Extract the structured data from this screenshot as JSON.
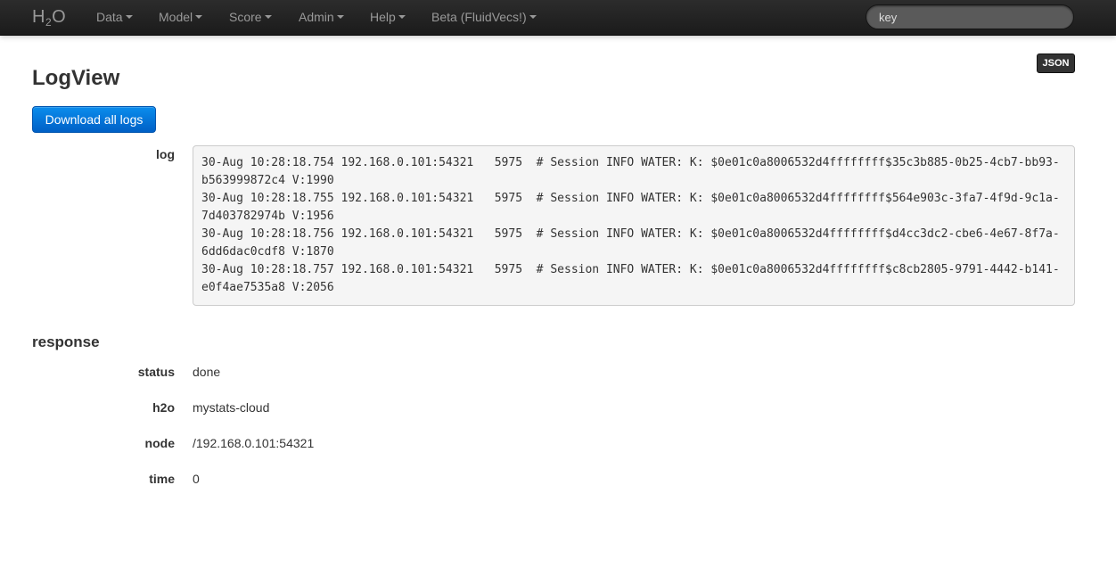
{
  "navbar": {
    "brand": {
      "main": "H",
      "sub": "2",
      "tail": "O"
    },
    "menu": [
      {
        "label": "Data"
      },
      {
        "label": "Model"
      },
      {
        "label": "Score"
      },
      {
        "label": "Admin"
      },
      {
        "label": "Help"
      },
      {
        "label": "Beta (FluidVecs!)"
      }
    ],
    "search": {
      "value": "",
      "placeholder": "key"
    }
  },
  "toolbar": {
    "json_label": "JSON"
  },
  "page": {
    "title": "LogView",
    "download_label": "Download all logs",
    "log_label": "log",
    "log_lines": [
      "30-Aug 10:28:18.754 192.168.0.101:54321   5975  # Session INFO WATER: K: $0e01c0a8006532d4ffffffff$35c3b885-0b25-4cb7-bb93-b563999872c4 V:1990",
      "30-Aug 10:28:18.755 192.168.0.101:54321   5975  # Session INFO WATER: K: $0e01c0a8006532d4ffffffff$564e903c-3fa7-4f9d-9c1a-7d403782974b V:1956",
      "30-Aug 10:28:18.756 192.168.0.101:54321   5975  # Session INFO WATER: K: $0e01c0a8006532d4ffffffff$d4cc3dc2-cbe6-4e67-8f7a-6dd6dac0cdf8 V:1870",
      "30-Aug 10:28:18.757 192.168.0.101:54321   5975  # Session INFO WATER: K: $0e01c0a8006532d4ffffffff$c8cb2805-9791-4442-b141-e0f4ae7535a8 V:2056"
    ]
  },
  "response": {
    "title": "response",
    "fields": [
      {
        "label": "status",
        "value": "done"
      },
      {
        "label": "h2o",
        "value": "mystats-cloud"
      },
      {
        "label": "node",
        "value": "/192.168.0.101:54321"
      },
      {
        "label": "time",
        "value": "0"
      }
    ]
  },
  "colors": {
    "navbar": "#1b1b1b",
    "primary_button": "#0060c6",
    "log_background": "#f5f5f5"
  }
}
